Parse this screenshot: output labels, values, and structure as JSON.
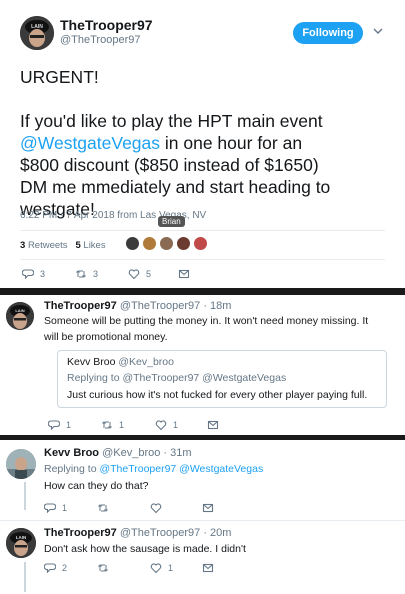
{
  "tweet": {
    "author_name": "TheTrooper97",
    "author_handle": "@TheTrooper97",
    "follow_label": "Following",
    "text_urgent": "URGENT!",
    "text_line1_pre": "If you'd like to play the HPT main event",
    "text_mention": "@WestgateVegas",
    "text_line2_post": " in one hour for an",
    "text_line3": "$800 discount ($850 instead of $1650)",
    "text_line4": "DM me mmediately and start heading to",
    "text_line5": "westgate!",
    "timestamp": "6:22 PM - 7 Apr 2018 from Las Vegas, NV",
    "tooltip": "Brian",
    "retweets_count": "3",
    "retweets_label": "Retweets",
    "likes_count": "5",
    "likes_label": "Likes",
    "actions": {
      "reply": "3",
      "retweet": "3",
      "like": "5"
    }
  },
  "reply1": {
    "name": "TheTrooper97",
    "handle": "@TheTrooper97 · 18m",
    "text_line1": "Someone will be putting the money in. It won't need money missing. It",
    "text_line2": "will be promotional money.",
    "quote": {
      "name": "Kevv Broo",
      "handle": "@Kev_broo",
      "replying_prefix": "Replying to ",
      "replying_mentions": "@TheTrooper97 @WestgateVegas",
      "text": "Just curious how it's not fucked for every other player paying full."
    },
    "actions": {
      "reply": "1",
      "retweet": "1",
      "like": "1"
    }
  },
  "reply2": {
    "name": "Kevv Broo",
    "handle": "@Kev_broo · 31m",
    "replying_prefix": "Replying to ",
    "replying_mentions": "@TheTrooper97 @WestgateVegas",
    "text": "How can they do that?",
    "actions": {
      "reply": "1",
      "retweet": "",
      "like": ""
    }
  },
  "reply3": {
    "name": "TheTrooper97",
    "handle": "@TheTrooper97 · 20m",
    "text": "Don't ask how the sausage is made. I didn't",
    "actions": {
      "reply": "2",
      "retweet": "",
      "like": "1"
    }
  },
  "colors": {
    "accent": "#1da1f2",
    "muted": "#657786",
    "separator": "#1a1a1a"
  },
  "icons": [
    "reply-icon",
    "retweet-icon",
    "like-icon",
    "dm-icon",
    "chevron-down-icon"
  ]
}
